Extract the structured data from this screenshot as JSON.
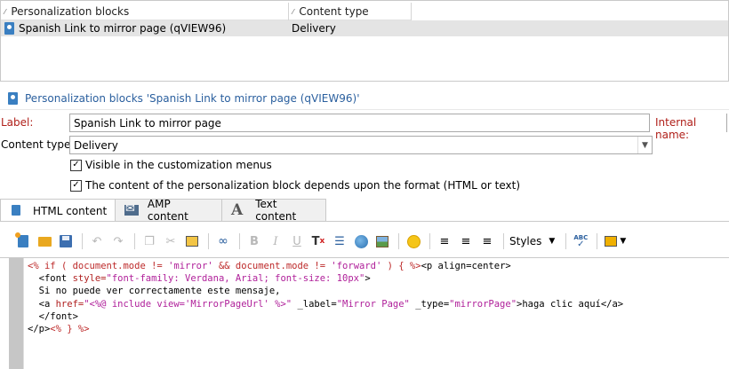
{
  "list": {
    "columns": [
      "Personalization blocks",
      "Content type"
    ],
    "rows": [
      {
        "name": "Spanish Link to mirror page (qVIEW96)",
        "content_type": "Delivery"
      }
    ]
  },
  "detail": {
    "title": "Personalization blocks 'Spanish Link to mirror page (qVIEW96)'",
    "label_caption": "Label:",
    "label_value": "Spanish Link to mirror page",
    "internal_name_caption": "Internal name:",
    "content_type_caption": "Content type:",
    "content_type_value": "Delivery",
    "checkbox_visible": "Visible in the customization menus",
    "checkbox_format": "The content of the personalization block depends upon the format (HTML or text)"
  },
  "tabs": [
    "HTML content",
    "AMP content",
    "Text content"
  ],
  "toolbar": {
    "styles_label": "Styles",
    "bold": "B",
    "italic": "I",
    "underline": "U",
    "clear_format": "T",
    "spellcheck": "ABC"
  },
  "code": {
    "line1_ctl_open": "<%",
    "line1_if": " if ( document.mode != ",
    "line1_str1": "'mirror'",
    "line1_and": " && document.mode != ",
    "line1_str2": "'forward'",
    "line1_close": " ) { ",
    "line1_ctl_end": "%>",
    "line1_tag": "<p align=center>",
    "line2_tag_open": "  <font ",
    "line2_attr": "style=",
    "line2_val": "\"font-family: Verdana, Arial; font-size: 10px\"",
    "line2_tag_close": ">",
    "line3": "  Si no puede ver correctamente este mensaje,",
    "line4_open": "  <a ",
    "line4_href": "href=",
    "line4_href_val": "\"<%@ include view='MirrorPageUrl' %>\"",
    "line4_label_attr": " _label=",
    "line4_label_val": "\"Mirror Page\"",
    "line4_type_attr": " _type=",
    "line4_type_val": "\"mirrorPage\"",
    "line4_text": ">haga clic aquí</a>",
    "line5": "  </font>",
    "line6_tag": "</p>",
    "line6_ctl": "<% } %>"
  }
}
